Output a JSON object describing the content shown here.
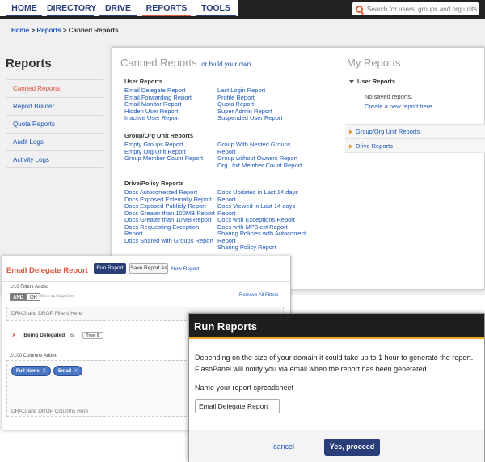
{
  "nav": {
    "items": [
      {
        "label": "HOME"
      },
      {
        "label": "DIRECTORY"
      },
      {
        "label": "DRIVE"
      },
      {
        "label": "REPORTS"
      },
      {
        "label": "TOOLS"
      }
    ],
    "active": "REPORTS",
    "search_placeholder": "Search for users, groups and org units"
  },
  "breadcrumb": {
    "home": "Home",
    "sep": ">",
    "reports": "Reports",
    "current": "Canned Reports"
  },
  "sidebar": {
    "title": "Reports",
    "items": [
      {
        "label": "Canned Reports"
      },
      {
        "label": "Report Builder"
      },
      {
        "label": "Quota Reports"
      },
      {
        "label": "Audit Logs"
      },
      {
        "label": "Activity Logs"
      }
    ]
  },
  "canned": {
    "title": "Canned Reports",
    "build_link": "or build your own",
    "user_reports": {
      "heading": "User Reports",
      "col1": [
        "Email Delegate Report",
        "Email Forwarding Report",
        "Email Monitor Report",
        "Hidden User Report",
        "Inactive User Report"
      ],
      "col2": [
        "Last Login Report",
        "Profile Report",
        "Quota Report",
        "Super Admin Report",
        "Suspended User Report"
      ]
    },
    "group_reports": {
      "heading": "Group/Org Unit Reports",
      "col1": [
        "Empty Groups Report",
        "Empty Org Unit Report",
        "Group Member Count Report"
      ],
      "col2": [
        "Group With Nested Groups",
        "Report",
        "Group without Owners Report",
        "Org Unit Member Count Report"
      ]
    },
    "drive_reports": {
      "heading": "Drive/Policy Reports",
      "col1": [
        "Docs Autocorrected Report",
        "Docs Exposed Externally Report",
        "Docs Exposed Publicly Report",
        "Docs Greater than 100MB Report",
        "Docs Greater than 10MB Report",
        "Docs Requesting Exception",
        "Report",
        "Docs Shared with Groups Report"
      ],
      "col2": [
        "Docs Updated in Last 14 days",
        "Report",
        "Docs Viewed in Last 14 days",
        "Report",
        "Docs with Exceptions Report",
        "Docs with MP3 ext Report",
        "Sharing Policies with Autocorrect",
        "Report",
        "Sharing Policy Report"
      ]
    }
  },
  "my_reports": {
    "title": "My Reports",
    "user_reports": "User Reports",
    "no_saved": "No saved reports.",
    "create_link": "Create a new report here",
    "group_reports": "Group/Org Unit Reports",
    "drive_reports": "Drive Reports"
  },
  "edr": {
    "title": "Email Delegate Report",
    "run_button": "Run Report",
    "save_button": "Save Report As",
    "new_link": "New Report",
    "filters_added": "1/10 Filters Added",
    "and": "AND",
    "or": "OR",
    "hint": "filters act together",
    "remove_all": "Remove All Filters",
    "drop_filters": "DRAG and DROP Filters Here",
    "filter_x": "X",
    "filter_name": "Being Delegated",
    "filter_op": "is",
    "filter_value": "True",
    "columns_added": "2/100 Columns Added",
    "chip_x": "X",
    "chips": [
      "Full Name",
      "Email"
    ],
    "drop_columns": "DRAG and DROP Columns Here"
  },
  "run_dialog": {
    "title": "Run Reports",
    "message": "Depending on the size of your domain it could take up to 1 hour to generate the report. FlashPanel will notify you via email when the report has been generated.",
    "label": "Name your report spreadsheet",
    "input_value": "Email Delegate Report",
    "cancel": "cancel",
    "proceed": "Yes, proceed"
  },
  "colors": {
    "nav_blue": "#2a3f7a",
    "accent_orange": "#d9573a",
    "link_blue": "#1a55b8",
    "dialog_bar": "#f0a826"
  }
}
